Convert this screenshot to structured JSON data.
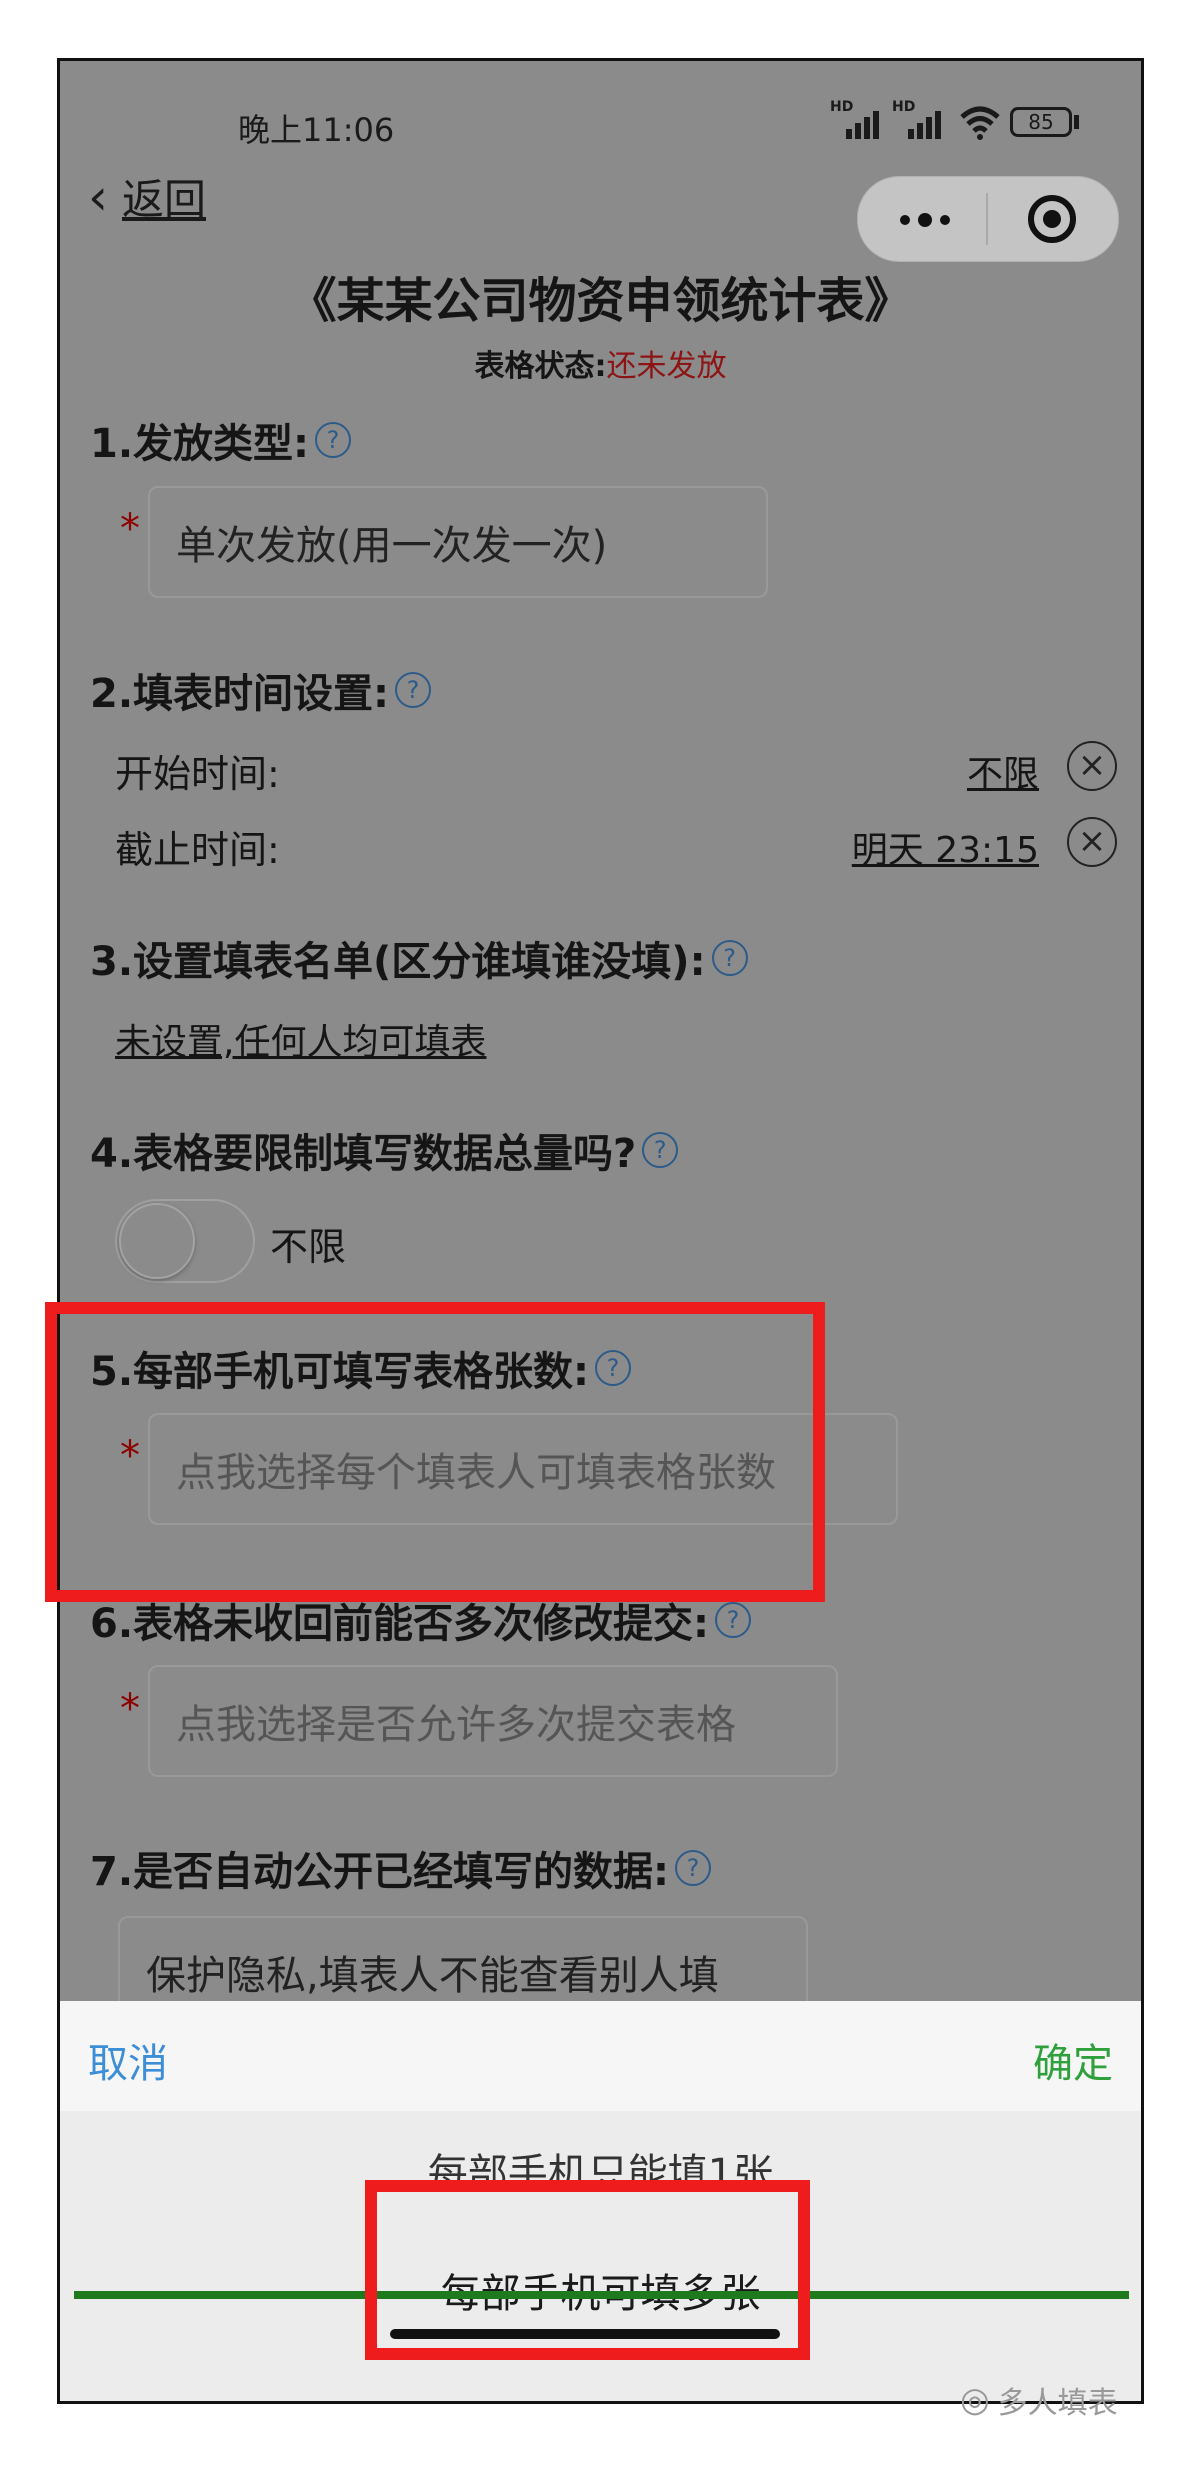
{
  "status_bar": {
    "time": "晚上11:06",
    "battery": "85",
    "signal_labels": [
      "HD",
      "HD"
    ]
  },
  "nav": {
    "back_label": "返回"
  },
  "form": {
    "title": "《某某公司物资申领统计表》",
    "status_label": "表格状态:",
    "status_value": "还未发放",
    "q1": {
      "label": "1.发放类型:",
      "value": "单次发放(用一次发一次)"
    },
    "q2": {
      "label": "2.填表时间设置:",
      "start_label": "开始时间:",
      "start_value": "不限",
      "end_label": "截止时间:",
      "end_value": "明天 23:15"
    },
    "q3": {
      "label": "3.设置填表名单(区分谁填谁没填):",
      "value": "未设置,任何人均可填表"
    },
    "q4": {
      "label": "4.表格要限制填写数据总量吗?",
      "toggle_label": "不限",
      "toggle_on": false
    },
    "q5": {
      "label": "5.每部手机可填写表格张数:",
      "placeholder": "点我选择每个填表人可填表格张数"
    },
    "q6": {
      "label": "6.表格未收回前能否多次修改提交:",
      "placeholder": "点我选择是否允许多次提交表格"
    },
    "q7": {
      "label": "7.是否自动公开已经填写的数据:",
      "value": "保护隐私,填表人不能查看别人填"
    },
    "help_glyph": "?",
    "required_mark": "*",
    "clear_glyph": "×"
  },
  "picker": {
    "cancel": "取消",
    "confirm": "确定",
    "options": [
      "每部手机只能填1张",
      "每部手机可填多张"
    ],
    "selected_index": 1
  },
  "watermark": "多人填表",
  "colors": {
    "overlay": "#8b8b8b",
    "highlight": "#ee1c1c",
    "cancel": "#3c8fd6",
    "confirm": "#2fa03c",
    "status": "#8d1414",
    "required": "#8d0000"
  }
}
